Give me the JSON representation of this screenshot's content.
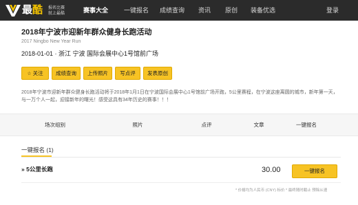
{
  "brand": {
    "name_main": "最",
    "name_accent": "酷",
    "slogan_line1": "报名比赛",
    "slogan_line2": "就上最酷",
    "logo_icon": "v-mark-logo-icon",
    "logo_color": "#f5c400"
  },
  "nav": {
    "items": [
      {
        "label": "赛事大全",
        "active": true
      },
      {
        "label": "一键报名",
        "active": false
      },
      {
        "label": "成绩查询",
        "active": false
      },
      {
        "label": "资讯",
        "active": false
      },
      {
        "label": "原创",
        "active": false
      },
      {
        "label": "装备优选",
        "active": false
      }
    ],
    "login_label": "登录"
  },
  "event": {
    "title": "2018年宁波市迎新年群众健身长跑活动",
    "subtitle": "2017 Ningbo New Year Run",
    "meta": "2018-01-01 · 浙江 宁波 国际会展中心1号馆前广场",
    "description": "2018年宁波市迎新年群众健身长跑活动将于2018年1月1日在宁波国际会展中心1号馆前广场开跑，5公里赛程，在宁波这座离圆的城市，新年第一天，与一万个人一起，迎接新年的曙光！感受这具有34年历史的赛事！！！"
  },
  "actions": {
    "follow_label": "关注",
    "follow_icon": "star-icon",
    "score_label": "成绩查询",
    "upload_label": "上传照片",
    "review_label": "写点评",
    "post_label": "发表原创"
  },
  "tabs": [
    "场次组别",
    "照片",
    "点评",
    "文章",
    "一键报名"
  ],
  "registration": {
    "section_label": "一键报名 (1)",
    "items": [
      {
        "name": "» 5公里长跑",
        "price": "30.00",
        "button_label": "一键报名"
      }
    ],
    "footnote": "* 价格均为人民币 (CNY) 标价 * 最终随时截止 预除从速"
  },
  "colors": {
    "accent": "#f7c324",
    "nav_bg": "#2b2b2b"
  }
}
